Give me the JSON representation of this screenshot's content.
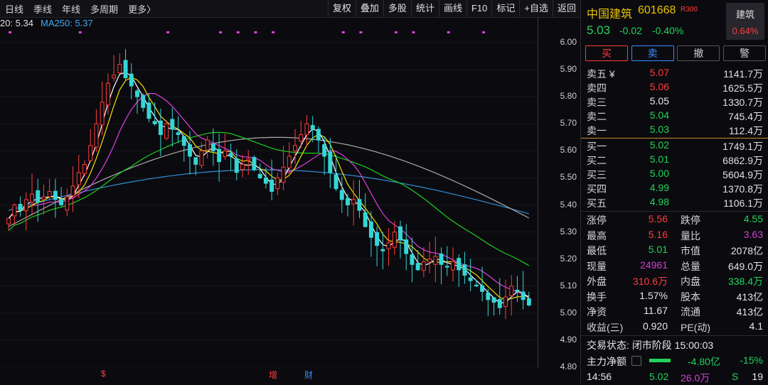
{
  "toolbar": {
    "left_tabs": [
      "日线",
      "季线",
      "年线",
      "多周期",
      "更多〉"
    ],
    "tools": [
      "复权",
      "叠加",
      "多股",
      "统计",
      "画线",
      "F10",
      "标记",
      "+自选",
      "返回"
    ]
  },
  "ma_legend": [
    {
      "text": "20: 5.34",
      "color": "#e0e0e0"
    },
    {
      "text": "MA250: 5.37",
      "color": "#3fa9f5"
    }
  ],
  "price_axis": [
    "6.00",
    "5.90",
    "5.80",
    "5.70",
    "5.60",
    "5.50",
    "5.40",
    "5.30",
    "5.20",
    "5.10",
    "5.00",
    "4.90",
    "4.80"
  ],
  "markers": [
    {
      "text": "$",
      "color": "#ff3b3b"
    },
    {
      "text": "增",
      "color": "#ff3b3b"
    },
    {
      "text": "财",
      "color": "#3a8cff"
    }
  ],
  "quote": {
    "name": "中国建筑",
    "code": "601668",
    "tag": "R300",
    "price": "5.03",
    "change": "-0.02",
    "change_pct": "-0.40%",
    "sector_name": "建筑",
    "sector_pct": "0.64%"
  },
  "actions": {
    "buy": "买",
    "sell": "卖",
    "cancel": "撤",
    "alert": "警"
  },
  "asks": [
    {
      "label": "卖五 ¥",
      "price": "5.07",
      "vol": "1141.7万",
      "color": "#ff3b3b"
    },
    {
      "label": "卖四",
      "price": "5.06",
      "vol": "1625.5万",
      "color": "#ff3b3b"
    },
    {
      "label": "卖三",
      "price": "5.05",
      "vol": "1330.7万",
      "color": "#e6e6e6"
    },
    {
      "label": "卖二",
      "price": "5.04",
      "vol": "745.4万",
      "color": "#24d15a"
    },
    {
      "label": "卖一",
      "price": "5.03",
      "vol": "112.4万",
      "color": "#24d15a"
    }
  ],
  "bids": [
    {
      "label": "买一",
      "price": "5.02",
      "vol": "1749.1万",
      "color": "#24d15a"
    },
    {
      "label": "买二",
      "price": "5.01",
      "vol": "6862.9万",
      "color": "#24d15a"
    },
    {
      "label": "买三",
      "price": "5.00",
      "vol": "5604.9万",
      "color": "#24d15a"
    },
    {
      "label": "买四",
      "price": "4.99",
      "vol": "1370.8万",
      "color": "#24d15a"
    },
    {
      "label": "买五",
      "price": "4.98",
      "vol": "1106.1万",
      "color": "#24d15a"
    }
  ],
  "stats": [
    {
      "l1": "涨停",
      "v1": "5.56",
      "c1": "#ff3b3b",
      "l2": "跌停",
      "v2": "4.55",
      "c2": "#24d15a"
    },
    {
      "l1": "最高",
      "v1": "5.16",
      "c1": "#ff3b3b",
      "l2": "量比",
      "v2": "3.63",
      "c2": "#d040d0"
    },
    {
      "l1": "最低",
      "v1": "5.01",
      "c1": "#24d15a",
      "l2": "市值",
      "v2": "2078亿",
      "c2": "#e6e6e6"
    },
    {
      "l1": "现量",
      "v1": "24961",
      "c1": "#d040d0",
      "l2": "总量",
      "v2": "649.0万",
      "c2": "#e6e6e6"
    },
    {
      "l1": "外盘",
      "v1": "310.6万",
      "c1": "#ff3b3b",
      "l2": "内盘",
      "v2": "338.4万",
      "c2": "#24d15a"
    },
    {
      "l1": "换手",
      "v1": "1.57%",
      "c1": "#e6e6e6",
      "l2": "股本",
      "v2": "413亿",
      "c2": "#e6e6e6"
    },
    {
      "l1": "净资",
      "v1": "11.67",
      "c1": "#e6e6e6",
      "l2": "流通",
      "v2": "413亿",
      "c2": "#e6e6e6"
    },
    {
      "l1": "收益(三)",
      "v1": "0.920",
      "c1": "#e6e6e6",
      "l2": "PE(动)",
      "v2": "4.1",
      "c2": "#e6e6e6"
    }
  ],
  "status": {
    "label": "交易状态:",
    "value": "闭市阶段 15:00:03"
  },
  "flow": {
    "label": "主力净额",
    "value": "-4.80亿",
    "pct": "-15%"
  },
  "last_tick": {
    "time": "14:56",
    "price": "5.02",
    "vol": "26.0万",
    "side": "S",
    "count": "19"
  },
  "chart_data": {
    "type": "candlestick",
    "y_axis_range": [
      4.8,
      6.05
    ],
    "y_ticks": [
      4.8,
      4.9,
      5.0,
      5.1,
      5.2,
      5.3,
      5.4,
      5.5,
      5.6,
      5.7,
      5.8,
      5.9,
      6.0
    ],
    "colors": {
      "up": "#ff3b3b",
      "down": "#35d6d6",
      "ma5": "#ffffff",
      "ma10": "#f5e100",
      "ma20": "#e040e0",
      "ma60": "#1ed01e",
      "ma120": "#aaaaaa",
      "ma250": "#2f8fd8"
    },
    "closes": [
      5.35,
      5.4,
      5.38,
      5.42,
      5.44,
      5.41,
      5.43,
      5.45,
      5.42,
      5.4,
      5.43,
      5.47,
      5.52,
      5.55,
      5.62,
      5.7,
      5.78,
      5.85,
      5.88,
      5.92,
      5.87,
      5.84,
      5.8,
      5.76,
      5.72,
      5.7,
      5.66,
      5.7,
      5.68,
      5.66,
      5.62,
      5.58,
      5.55,
      5.6,
      5.64,
      5.6,
      5.56,
      5.6,
      5.58,
      5.52,
      5.55,
      5.57,
      5.53,
      5.5,
      5.48,
      5.45,
      5.5,
      5.54,
      5.58,
      5.62,
      5.66,
      5.7,
      5.68,
      5.64,
      5.58,
      5.52,
      5.46,
      5.42,
      5.4,
      5.42,
      5.38,
      5.32,
      5.28,
      5.25,
      5.23,
      5.26,
      5.3,
      5.27,
      5.22,
      5.18,
      5.16,
      5.19,
      5.2,
      5.21,
      5.18,
      5.17,
      5.19,
      5.16,
      5.14,
      5.12,
      5.1,
      5.08,
      5.05,
      5.04,
      5.02,
      5.06,
      5.1,
      5.08,
      5.05,
      5.03
    ]
  }
}
